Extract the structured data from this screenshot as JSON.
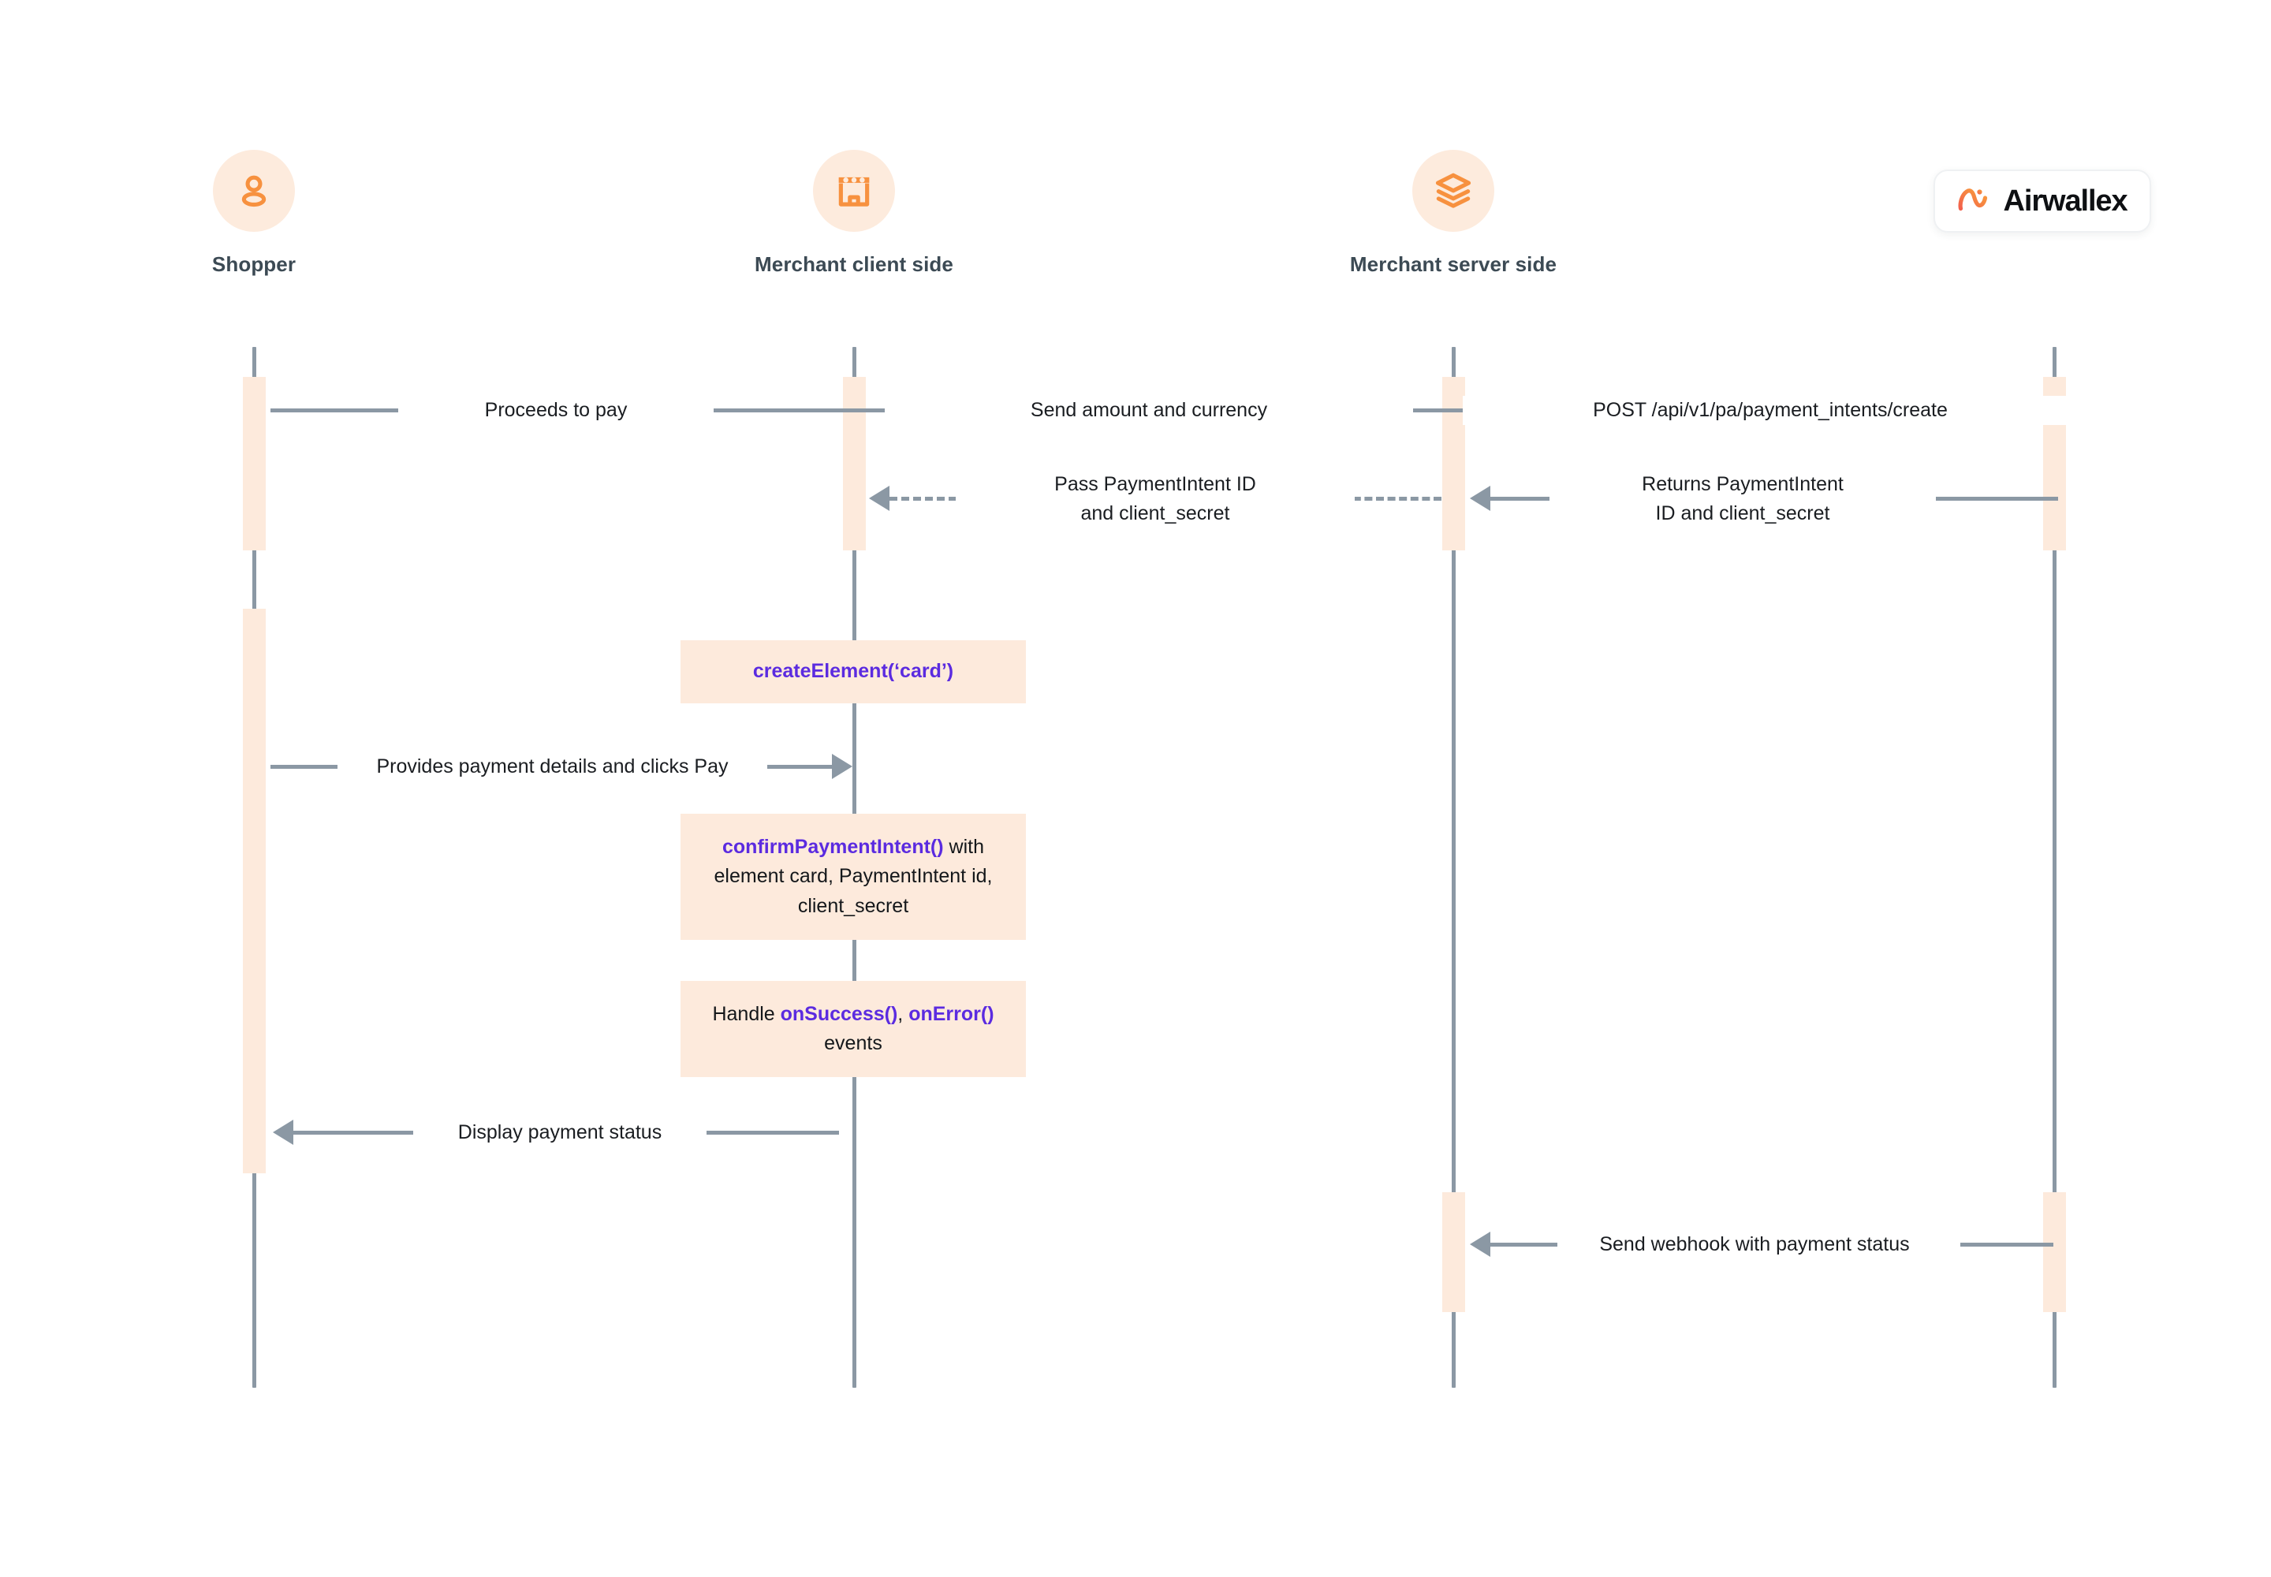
{
  "brand": {
    "name": "Airwallex",
    "logo_icon": "airwallex-logo-icon",
    "accent_start": "#F2604C",
    "accent_end": "#F7913F"
  },
  "theme": {
    "activation_fill": "#FDEADC",
    "note_fill": "#FDEADC",
    "lifeline_stroke": "#8B98A4",
    "icon_circle_fill": "#FDEBDD",
    "icon_color": "#F7913F",
    "code_color": "#5B2BE0",
    "text_color": "#1A1D21",
    "label_color": "#3C4A54",
    "background": "#FFFFFF"
  },
  "participants": [
    {
      "id": "shopper",
      "label": "Shopper",
      "icon": "user-icon"
    },
    {
      "id": "merchant-client",
      "label": "Merchant client side",
      "icon": "store-icon"
    },
    {
      "id": "merchant-server",
      "label": "Merchant server side",
      "icon": "layers-icon"
    },
    {
      "id": "airwallex",
      "label": "",
      "icon": "airwallex-logo-icon"
    }
  ],
  "messages": [
    {
      "id": "m1",
      "text": "Proceeds to pay",
      "from": "shopper",
      "to": "merchant-client",
      "style": "solid",
      "direction": "right"
    },
    {
      "id": "m2",
      "text": "Send amount and currency",
      "from": "merchant-client",
      "to": "merchant-server",
      "style": "solid",
      "direction": "right"
    },
    {
      "id": "m3",
      "text": "POST /api/v1/pa/payment_intents/create",
      "from": "merchant-server",
      "to": "airwallex",
      "style": "solid",
      "direction": "right"
    },
    {
      "id": "m4",
      "text": "Pass PaymentIntent ID\nand client_secret",
      "from": "merchant-server",
      "to": "merchant-client",
      "style": "dashed",
      "direction": "left"
    },
    {
      "id": "m5",
      "text": "Returns PaymentIntent\nID and client_secret",
      "from": "airwallex",
      "to": "merchant-server",
      "style": "solid",
      "direction": "left"
    },
    {
      "id": "m6",
      "text": "Provides payment details and clicks Pay",
      "from": "shopper",
      "to": "merchant-client",
      "style": "solid",
      "direction": "right"
    },
    {
      "id": "m7",
      "text": "Display payment status",
      "from": "merchant-client",
      "to": "shopper",
      "style": "solid",
      "direction": "left"
    },
    {
      "id": "m8",
      "text": "Send webhook with payment status",
      "from": "airwallex",
      "to": "merchant-server",
      "style": "solid",
      "direction": "left"
    }
  ],
  "notes": [
    {
      "id": "n1",
      "on": "merchant-client",
      "parts": [
        {
          "text": "createElement(‘card’)",
          "code": true
        }
      ]
    },
    {
      "id": "n2",
      "on": "merchant-client",
      "parts": [
        {
          "text": "confirmPaymentIntent()",
          "code": true
        },
        {
          "text": " with element card, PaymentIntent id, client_secret",
          "code": false
        }
      ]
    },
    {
      "id": "n3",
      "on": "merchant-client",
      "parts": [
        {
          "text": "Handle ",
          "code": false
        },
        {
          "text": "onSuccess()",
          "code": true
        },
        {
          "text": ", ",
          "code": false
        },
        {
          "text": "onError()",
          "code": true
        },
        {
          "text": " events",
          "code": false
        }
      ]
    }
  ]
}
